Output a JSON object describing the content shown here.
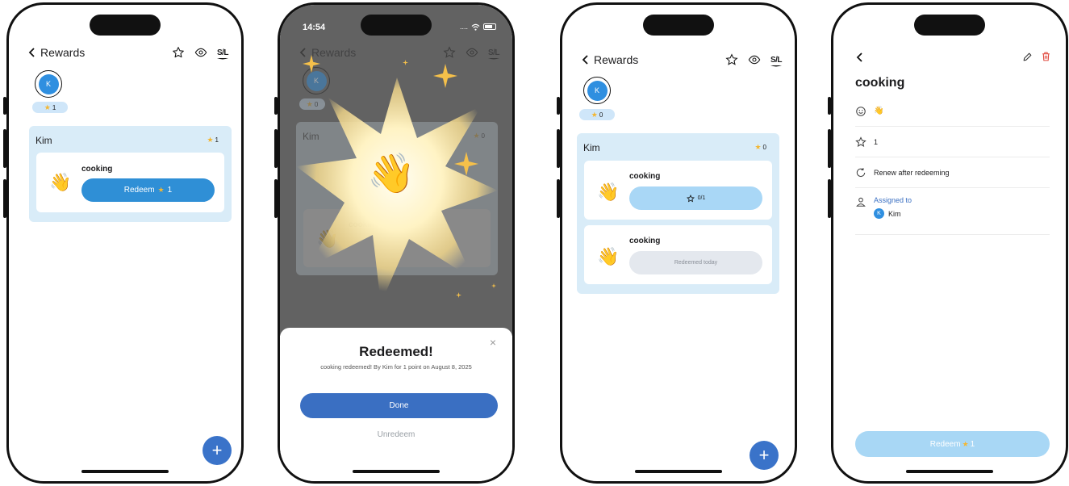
{
  "screen1": {
    "header": {
      "back_label": "Rewards",
      "sl_label": "S/L"
    },
    "user": {
      "initial": "K",
      "points": "1"
    },
    "panel": {
      "name": "Kim",
      "points": "1"
    },
    "reward": {
      "title": "cooking",
      "emoji": "👋",
      "button_label": "Redeem",
      "button_points": "1"
    },
    "fab_icon": "+"
  },
  "screen2": {
    "status": {
      "time": "14:54",
      "signal": "....",
      "wifi": "wifi-icon"
    },
    "header": {
      "back_label": "Rewards",
      "sl_label": "S/L"
    },
    "user": {
      "initial": "K",
      "points": "0"
    },
    "panel": {
      "name": "Kim",
      "points": "0"
    },
    "background_reward": {
      "title": "cooking",
      "emoji": "👋"
    },
    "celebration_emoji": "👋",
    "sheet": {
      "title": "Redeemed!",
      "message": "cooking redeemed!   By Kim for 1 point on August 8, 2025",
      "done_label": "Done",
      "unredeem_label": "Unredeem",
      "close_icon": "×"
    }
  },
  "screen3": {
    "header": {
      "back_label": "Rewards",
      "sl_label": "S/L"
    },
    "user": {
      "initial": "K",
      "points": "0"
    },
    "panel": {
      "name": "Kim",
      "points": "0"
    },
    "rewards": [
      {
        "title": "cooking",
        "emoji": "👋",
        "status": "0/1"
      },
      {
        "title": "cooking",
        "emoji": "👋",
        "status": "Redeemed today"
      }
    ],
    "fab_icon": "+"
  },
  "screen4": {
    "title": "cooking",
    "emoji_value": "👋",
    "points_value": "1",
    "renew_label": "Renew after redeeming",
    "assigned_label": "Assigned to",
    "assignee": {
      "initial": "K",
      "name": "Kim"
    },
    "redeem_label": "Redeem",
    "redeem_points": "1"
  },
  "colors": {
    "accent": "#2f8fd6",
    "panel": "#d9ecf8",
    "star": "#f3b632",
    "delete": "#e0453a",
    "done": "#3a6fc2"
  }
}
